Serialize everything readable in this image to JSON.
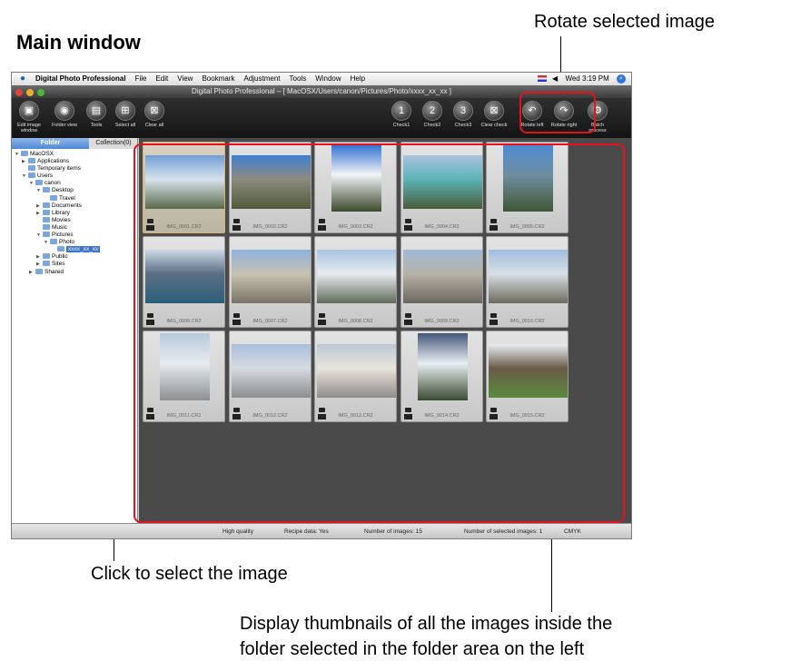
{
  "heading": "Main window",
  "callouts": {
    "rotate": "Rotate selected image",
    "click": "Click to select the image",
    "display_line1": "Display thumbnails of all the images inside the",
    "display_line2": "folder selected in the folder area on the left"
  },
  "menubar": {
    "apple": "",
    "items": [
      "Digital Photo Professional",
      "File",
      "Edit",
      "View",
      "Bookmark",
      "Adjustment",
      "Tools",
      "Window",
      "Help"
    ],
    "clock": "Wed 3:19 PM",
    "volume": "◀"
  },
  "window_title": "Digital Photo Professional – [ MacOSX/Users/canon/Pictures/Photo/xxxx_xx_xx ]",
  "toolbar": {
    "left": [
      {
        "label": "Edit image window",
        "icon": "edit-image-window-icon",
        "glyph": "▣"
      },
      {
        "label": "Folder view",
        "icon": "folder-view-icon",
        "glyph": "◉"
      },
      {
        "label": "Tools",
        "icon": "tools-icon",
        "glyph": "▤"
      },
      {
        "label": "Select all",
        "icon": "select-all-icon",
        "glyph": "⊞"
      },
      {
        "label": "Clear all",
        "icon": "clear-all-icon",
        "glyph": "⊠"
      }
    ],
    "right": [
      {
        "label": "Check1",
        "icon": "check1-icon",
        "glyph": "1"
      },
      {
        "label": "Check2",
        "icon": "check2-icon",
        "glyph": "2"
      },
      {
        "label": "Check3",
        "icon": "check3-icon",
        "glyph": "3"
      },
      {
        "label": "Clear check",
        "icon": "clear-check-icon",
        "glyph": "⊠"
      },
      {
        "label": "Rotate left",
        "icon": "rotate-left-icon",
        "glyph": "↶"
      },
      {
        "label": "Rotate right",
        "icon": "rotate-right-icon",
        "glyph": "↷"
      },
      {
        "label": "Batch process",
        "icon": "batch-process-icon",
        "glyph": "⚙"
      }
    ]
  },
  "tabs": {
    "folder": "Folder",
    "collection": "Collection(0)"
  },
  "tree": [
    {
      "label": "MacOSX",
      "depth": 0,
      "tri": "▼"
    },
    {
      "label": "Applications",
      "depth": 1,
      "tri": "▶"
    },
    {
      "label": "Temporary items",
      "depth": 1,
      "tri": ""
    },
    {
      "label": "Users",
      "depth": 1,
      "tri": "▼"
    },
    {
      "label": "canon",
      "depth": 2,
      "tri": "▼"
    },
    {
      "label": "Desktop",
      "depth": 3,
      "tri": "▼"
    },
    {
      "label": "Travel",
      "depth": 4,
      "tri": ""
    },
    {
      "label": "Documents",
      "depth": 3,
      "tri": "▶"
    },
    {
      "label": "Library",
      "depth": 3,
      "tri": "▶"
    },
    {
      "label": "Movies",
      "depth": 3,
      "tri": ""
    },
    {
      "label": "Music",
      "depth": 3,
      "tri": ""
    },
    {
      "label": "Pictures",
      "depth": 3,
      "tri": "▼"
    },
    {
      "label": "Photo",
      "depth": 4,
      "tri": "▼"
    },
    {
      "label": "xxxx_xx_xx",
      "depth": 5,
      "tri": "",
      "selected": true
    },
    {
      "label": "Public",
      "depth": 3,
      "tri": "▶"
    },
    {
      "label": "Sites",
      "depth": 3,
      "tri": "▶"
    },
    {
      "label": "Shared",
      "depth": 2,
      "tri": "▶"
    }
  ],
  "thumbnails": [
    {
      "caption": "IMG_0001.CR2",
      "selected": true,
      "orient": "landscape",
      "colors": [
        "#6f9fd6",
        "#d8e2ee",
        "#5a6b4a"
      ]
    },
    {
      "caption": "IMG_0002.CR2",
      "orient": "landscape",
      "colors": [
        "#3f7fd2",
        "#8e8a7e",
        "#4e5a3a"
      ]
    },
    {
      "caption": "IMG_0003.CR2",
      "orient": "portrait",
      "colors": [
        "#2f6fcf",
        "#f1f3f7",
        "#3c4a2e"
      ]
    },
    {
      "caption": "IMG_0004.CR2",
      "orient": "landscape",
      "colors": [
        "#aac3de",
        "#5bb3b5",
        "#4a5b3a"
      ]
    },
    {
      "caption": "IMG_0005.CR2",
      "orient": "portrait",
      "colors": [
        "#4f89d4",
        "#6e8ea0",
        "#3f5734"
      ]
    },
    {
      "caption": "IMG_0006.CR2",
      "orient": "landscape",
      "colors": [
        "#cfd9e6",
        "#5b6e84",
        "#2d5f7a"
      ]
    },
    {
      "caption": "IMG_0007.CR2",
      "orient": "landscape",
      "colors": [
        "#8fb2dc",
        "#c8c2b2",
        "#7a7466"
      ]
    },
    {
      "caption": "IMG_0008.CR2",
      "orient": "landscape",
      "colors": [
        "#a9c3e2",
        "#e8ecf0",
        "#5f6a5a"
      ]
    },
    {
      "caption": "IMG_0009.CR2",
      "orient": "landscape",
      "colors": [
        "#9fb9d9",
        "#b7b2a6",
        "#6b6660"
      ]
    },
    {
      "caption": "IMG_0010.CR2",
      "orient": "landscape",
      "colors": [
        "#9fbcdf",
        "#d9dfe6",
        "#6e6a60"
      ]
    },
    {
      "caption": "IMG_0011.CR2",
      "orient": "portrait",
      "colors": [
        "#b9c9dc",
        "#e6ebef",
        "#8c8f92"
      ]
    },
    {
      "caption": "IMG_0012.CR2",
      "orient": "landscape",
      "colors": [
        "#a8bfdc",
        "#d7dbe0",
        "#8a8d8f"
      ]
    },
    {
      "caption": "IMG_0013.CR2",
      "orient": "landscape",
      "colors": [
        "#bcc7d4",
        "#e9e4dc",
        "#8f8d88"
      ]
    },
    {
      "caption": "IMG_0014.CR2",
      "orient": "portrait",
      "colors": [
        "#44577a",
        "#e8eef2",
        "#3a4a32"
      ]
    },
    {
      "caption": "IMG_0015.CR2",
      "orient": "landscape",
      "colors": [
        "#e9eef4",
        "#6b5b48",
        "#5a8a3e"
      ]
    }
  ],
  "status": {
    "quality": "High quality",
    "recipe": "Recipe data: Yes",
    "count": "Number of images: 15",
    "selected": "Number of selected images: 1",
    "color": "CMYK"
  },
  "colors": {
    "highlight": "#e3121d",
    "selection": "#3b74d1"
  }
}
